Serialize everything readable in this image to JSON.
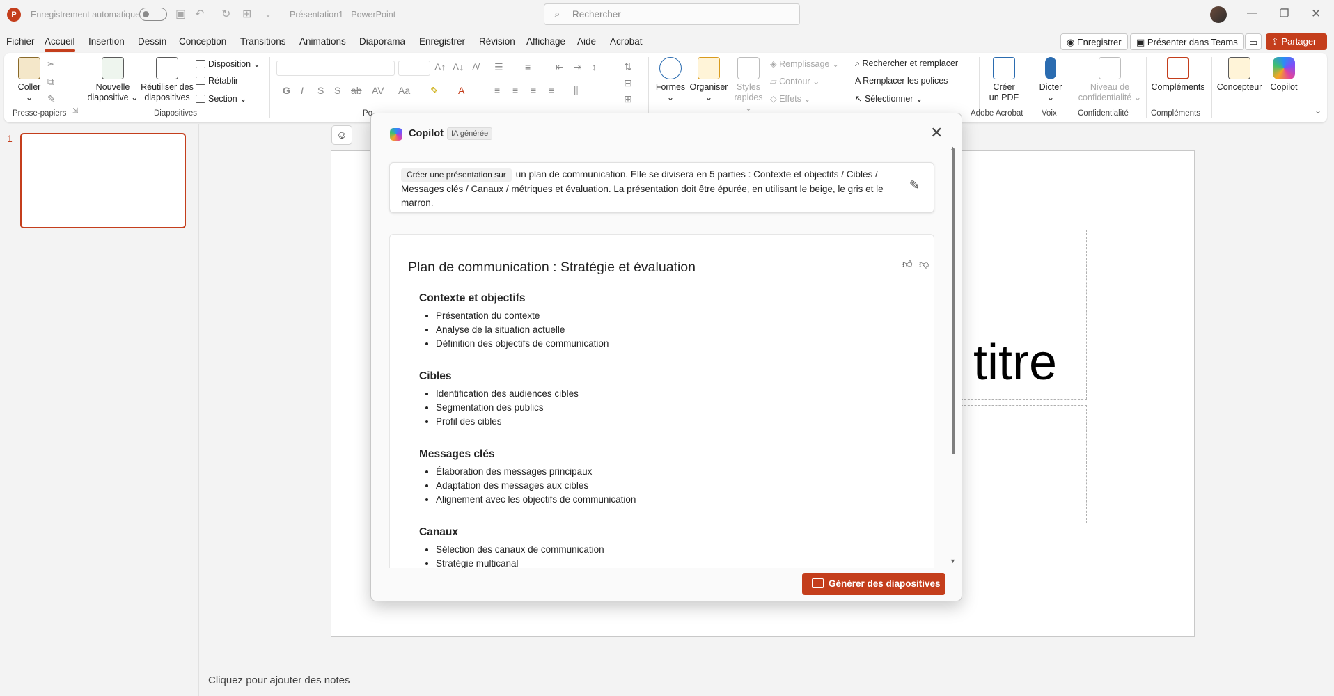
{
  "titlebar": {
    "app_icon": "P",
    "autosave_label": "Enregistrement automatique",
    "document_title": "Présentation1  -  PowerPoint",
    "search_placeholder": "Rechercher",
    "window_controls": [
      "minimize-icon",
      "restore-icon",
      "close-icon"
    ]
  },
  "tabs": [
    "Fichier",
    "Accueil",
    "Insertion",
    "Dessin",
    "Conception",
    "Transitions",
    "Animations",
    "Diaporama",
    "Enregistrer",
    "Révision",
    "Affichage",
    "Aide",
    "Acrobat"
  ],
  "active_tab": "Accueil",
  "top_actions": {
    "record": "Enregistrer",
    "teams": "Présenter dans Teams",
    "share": "Partager"
  },
  "ribbon": {
    "clipboard": {
      "paste": "Coller",
      "group": "Presse-papiers"
    },
    "slides": {
      "new_slide_1": "Nouvelle",
      "new_slide_2": "diapositive",
      "reuse_1": "Réutiliser des",
      "reuse_2": "diapositives",
      "layout": "Disposition",
      "reset": "Rétablir",
      "section": "Section",
      "group": "Diapositives"
    },
    "font": {
      "group": "Po"
    },
    "drawing": {
      "shapes": "Formes",
      "arrange": "Organiser",
      "styles_1": "Styles",
      "styles_2": "rapides",
      "fill": "Remplissage",
      "outline": "Contour",
      "effects": "Effets"
    },
    "editing": {
      "find": "Rechercher et remplacer",
      "replace_fonts": "Remplacer les polices",
      "select": "Sélectionner"
    },
    "acrobat": {
      "create_pdf_1": "Créer",
      "create_pdf_2": "un PDF",
      "group": "Adobe Acrobat"
    },
    "voice": {
      "dictate": "Dicter",
      "group": "Voix"
    },
    "sensitivity": {
      "label_1": "Niveau de",
      "label_2": "confidentialité",
      "group": "Confidentialité"
    },
    "addins": {
      "label": "Compléments",
      "group": "Compléments"
    },
    "designer": "Concepteur",
    "copilot": "Copilot"
  },
  "slides_panel": {
    "slide_number": "1"
  },
  "canvas": {
    "title_text": "titre"
  },
  "notes_placeholder": "Cliquez pour ajouter des notes",
  "copilot_dialog": {
    "title": "Copilot",
    "badge": "IA générée",
    "prompt_chip": "Créer une présentation sur",
    "prompt_text": "un plan de communication.  Elle se divisera en 5 parties : Contexte et objectifs / Cibles / Messages clés / Canaux / métriques et évaluation. La présentation doit être épurée, en utilisant le beige, le gris et le marron.",
    "outline_title": "Plan de communication : Stratégie et évaluation",
    "sections": [
      {
        "heading": "Contexte et objectifs",
        "items": [
          "Présentation du contexte",
          "Analyse de la situation actuelle",
          "Définition des objectifs de communication"
        ]
      },
      {
        "heading": "Cibles",
        "items": [
          "Identification des audiences cibles",
          "Segmentation des publics",
          "Profil des cibles"
        ]
      },
      {
        "heading": "Messages clés",
        "items": [
          "Élaboration des messages principaux",
          "Adaptation des messages aux cibles",
          "Alignement avec les objectifs de communication"
        ]
      },
      {
        "heading": "Canaux",
        "items": [
          "Sélection des canaux de communication",
          "Stratégie multicanal"
        ]
      }
    ],
    "generate_button": "Générer des diapositives"
  },
  "colors": {
    "accent": "#c43e1c",
    "background": "#f3f3f3"
  }
}
